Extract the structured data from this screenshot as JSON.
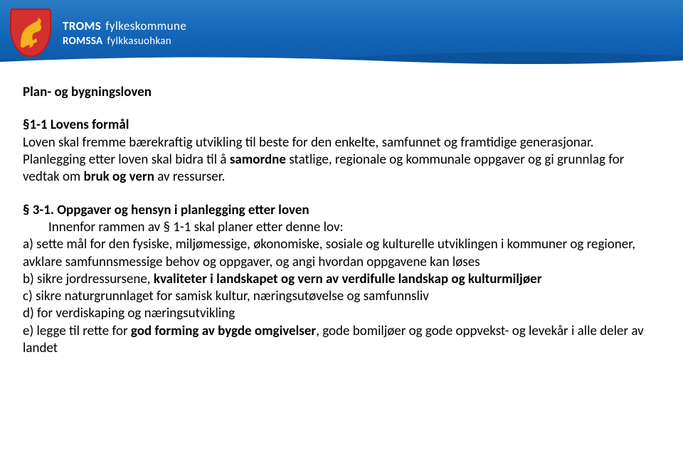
{
  "header": {
    "org_no": "TROMS",
    "org_no_suffix": "fylkeskommune",
    "org_se": "ROMSSA",
    "org_se_suffix": "fylkkasuohkan"
  },
  "title": "Plan- og bygningsloven",
  "section1": {
    "heading": "§1-1 Lovens formål",
    "p1": "Loven skal fremme bærekraftig utvikling til beste for den enkelte, samfunnet og framtidige generasjonar.",
    "p2a": "Planlegging etter loven skal bidra til å ",
    "p2b_bold": "samordne",
    "p2c": " statlige, regionale og kommunale oppgaver og gi grunnlag for vedtak om ",
    "p2d_bold": "bruk og vern",
    "p2e": " av ressurser."
  },
  "section3": {
    "heading": "§ 3-1. Oppgaver og hensyn i planlegging etter loven",
    "intro": "Innenfor rammen av § 1-1 skal planer etter denne lov:",
    "a": "a) sette mål for den fysiske, miljømessige, økonomiske, sosiale og kulturelle utviklingen i kommuner og regioner, avklare samfunnsmessige behov og oppgaver, og angi hvordan oppgavene kan løses",
    "b_pre": "b) sikre jordressursene, ",
    "b_bold": "kvaliteter i landskapet og vern av verdifulle landskap og kulturmiljøer",
    "c": "c) sikre naturgrunnlaget for samisk kultur, næringsutøvelse og samfunnsliv",
    "d": "d) for verdiskaping og næringsutvikling",
    "e_pre": "e) legge til rette for ",
    "e_bold": "god forming av bygde omgivelser",
    "e_post": ", gode bomiljøer og gode oppvekst- og levekår i alle deler av landet"
  }
}
